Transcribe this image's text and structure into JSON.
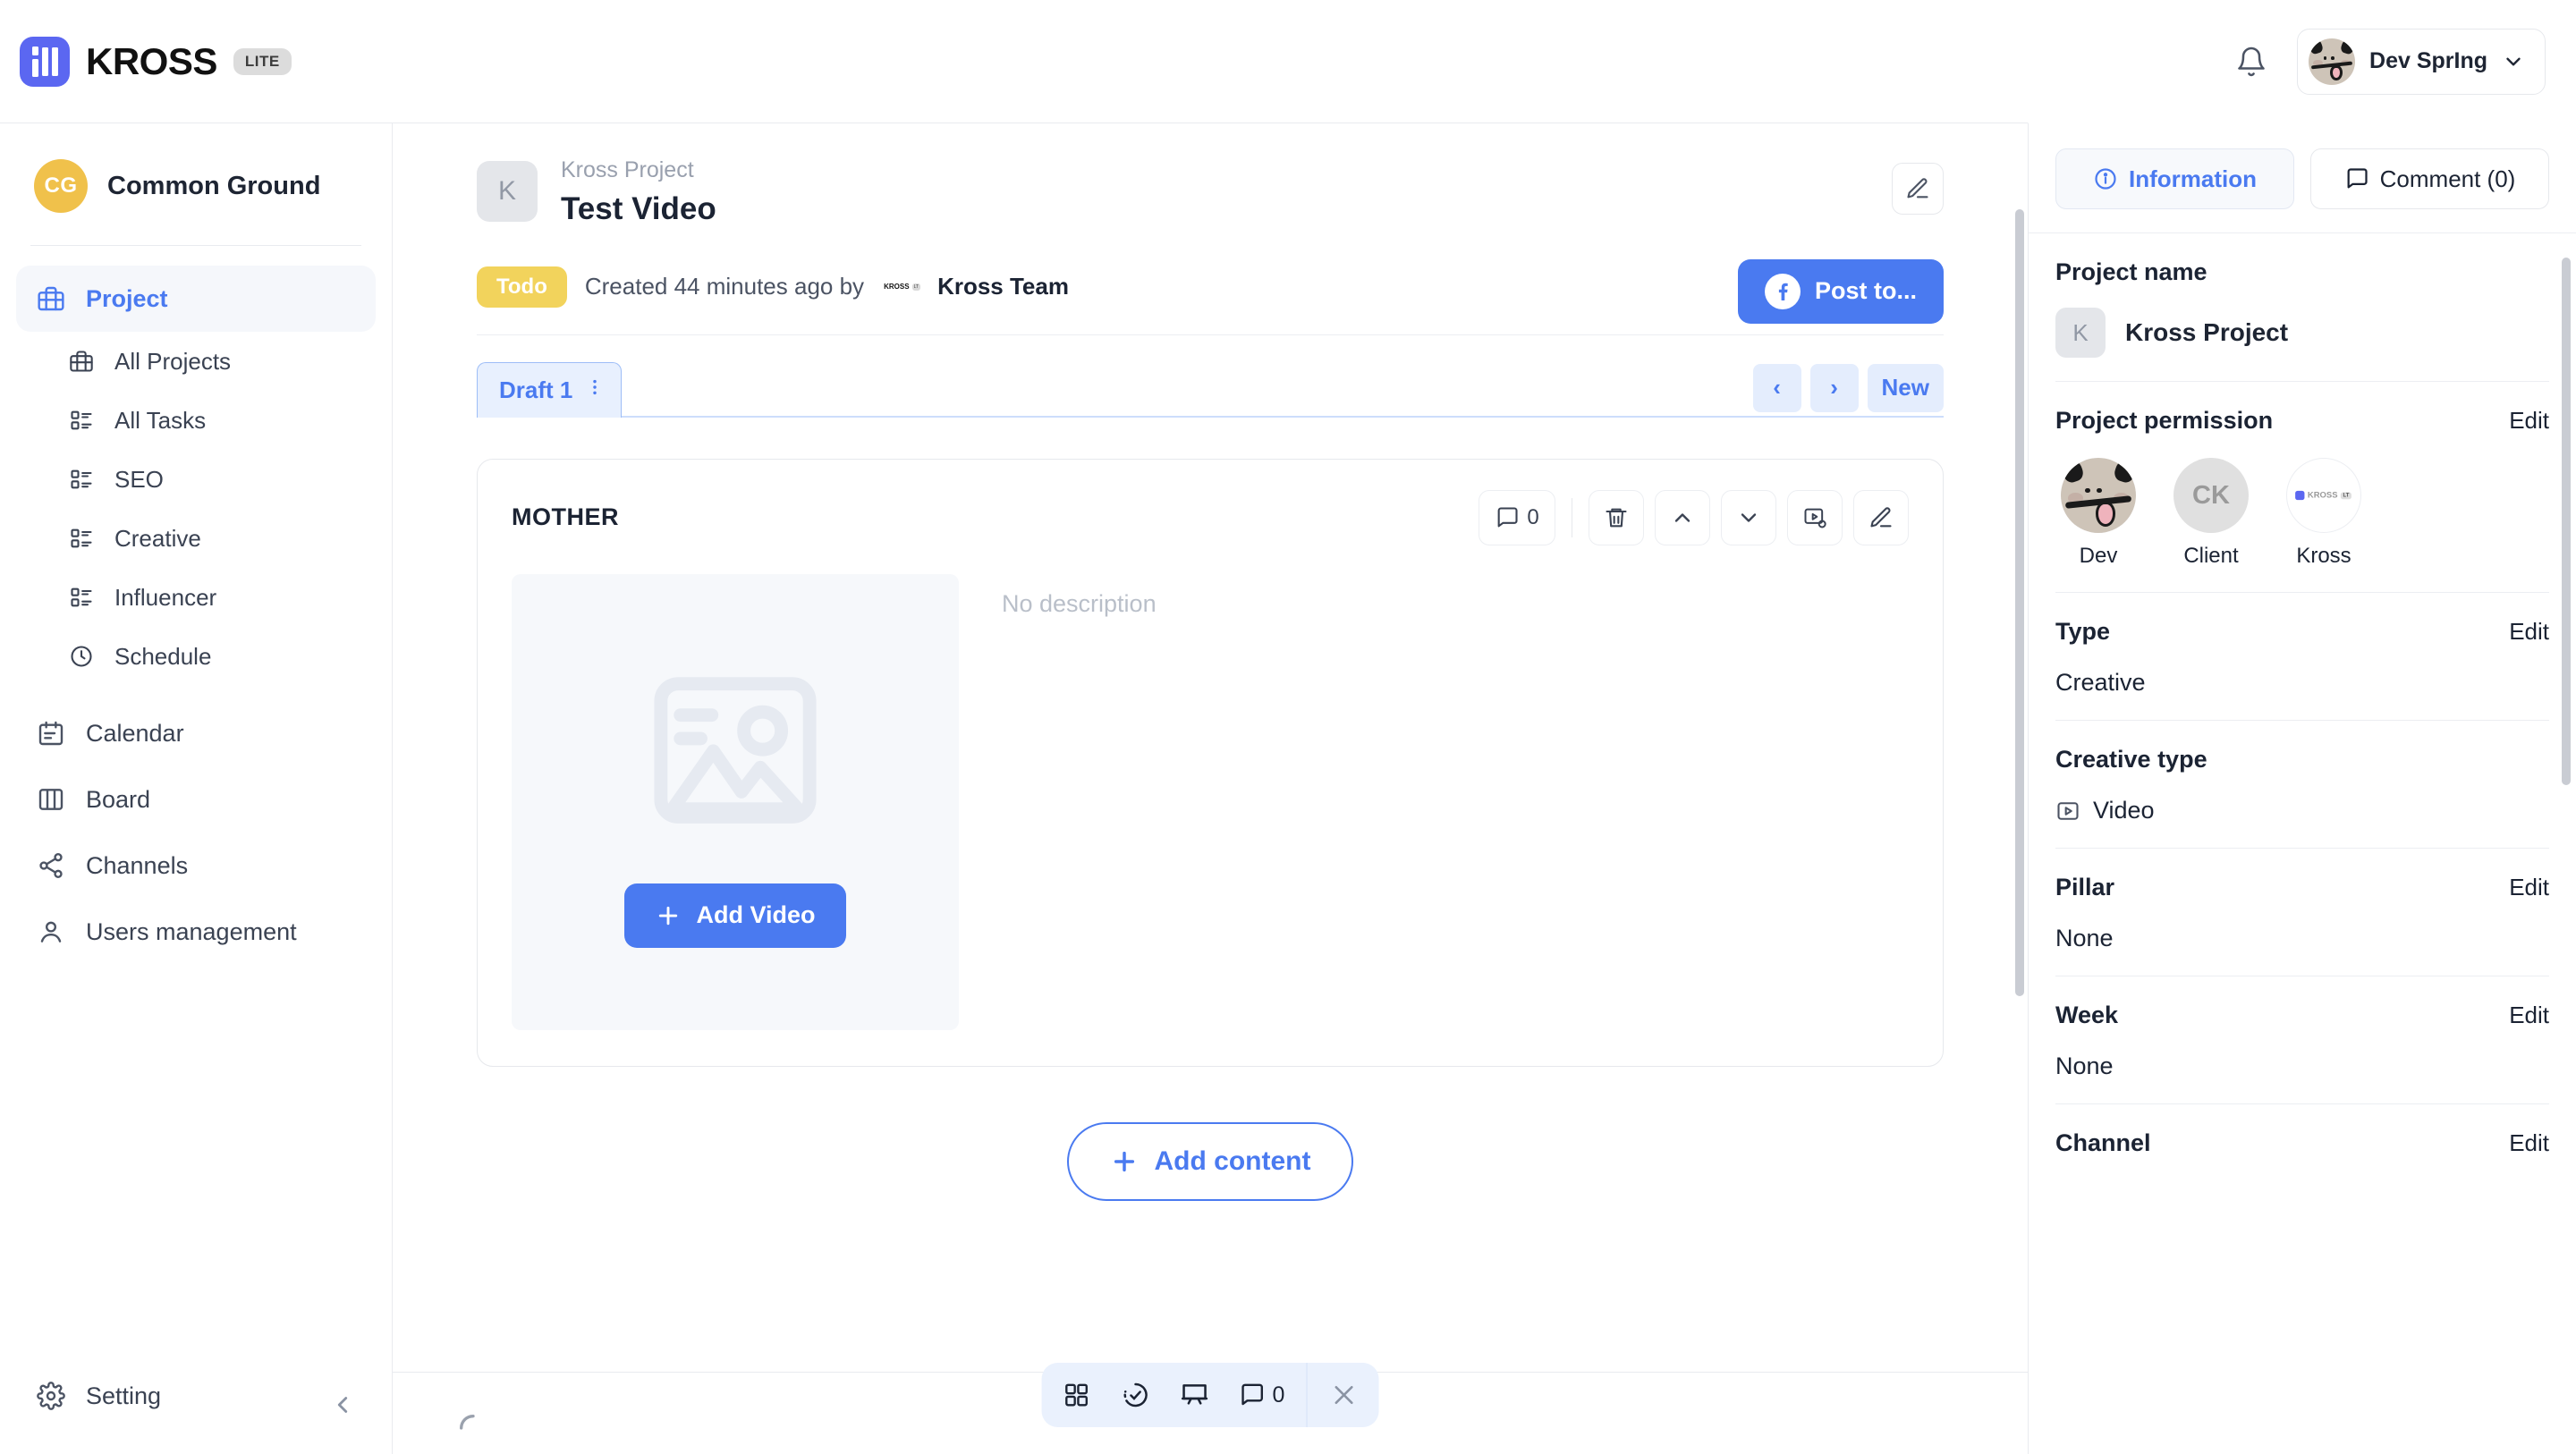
{
  "brand": {
    "name": "KROSS",
    "badge": "LITE",
    "logo_color": "#5b67f1"
  },
  "topbar": {
    "notifications_icon": "bell-icon",
    "user_name": "Dev SprIng",
    "chevron": "chevron-down-icon"
  },
  "sidebar": {
    "workspace": {
      "initials": "CG",
      "name": "Common Ground",
      "color": "#f0c14b"
    },
    "items": [
      {
        "label": "Project",
        "icon": "briefcase-icon",
        "active": true,
        "sub": false
      },
      {
        "label": "All Projects",
        "icon": "briefcase-icon",
        "active": false,
        "sub": true
      },
      {
        "label": "All Tasks",
        "icon": "list-layout-icon",
        "active": false,
        "sub": true
      },
      {
        "label": "SEO",
        "icon": "list-layout-icon",
        "active": false,
        "sub": true
      },
      {
        "label": "Creative",
        "icon": "list-layout-icon",
        "active": false,
        "sub": true
      },
      {
        "label": "Influencer",
        "icon": "list-layout-icon",
        "active": false,
        "sub": true
      },
      {
        "label": "Schedule",
        "icon": "clock-icon",
        "active": false,
        "sub": true
      },
      {
        "label": "Calendar",
        "icon": "calendar-icon",
        "active": false,
        "sub": false
      },
      {
        "label": "Board",
        "icon": "columns-icon",
        "active": false,
        "sub": false
      },
      {
        "label": "Channels",
        "icon": "share-nodes-icon",
        "active": false,
        "sub": false
      },
      {
        "label": "Users management",
        "icon": "user-icon",
        "active": false,
        "sub": false
      }
    ],
    "setting": {
      "label": "Setting",
      "icon": "gear-icon"
    },
    "collapse_icon": "chevron-left-icon"
  },
  "document": {
    "project_initial": "K",
    "project_label": "Kross Project",
    "title": "Test Video",
    "edit_icon": "pencil-icon",
    "status_badge": "Todo",
    "status_color": "#f2d35c",
    "created_text": "Created 44 minutes ago by",
    "author": "Kross Team",
    "post_button": "Post to...",
    "post_icon": "facebook-icon"
  },
  "drafts": {
    "tab_label": "Draft 1",
    "tab_menu_icon": "vertical-dots-icon",
    "prev_label": "‹",
    "next_label": "›",
    "new_label": "New"
  },
  "content_card": {
    "title": "MOTHER",
    "comment_count": "0",
    "tools": [
      {
        "name": "comment-icon",
        "label": "0"
      },
      {
        "name": "trash-icon",
        "label": ""
      },
      {
        "name": "chevron-up-icon",
        "label": ""
      },
      {
        "name": "chevron-down-icon",
        "label": ""
      },
      {
        "name": "video-settings-icon",
        "label": ""
      },
      {
        "name": "pencil-icon",
        "label": ""
      }
    ],
    "placeholder_icon": "image-placeholder-icon",
    "add_video_label": "Add Video",
    "no_description": "No description"
  },
  "add_content_label": "Add content",
  "float_toolbar": {
    "grid_icon": "grid-icon",
    "progress_icon": "progress-check-icon",
    "board_icon": "presentation-icon",
    "comment_icon": "comment-icon",
    "comment_count": "0",
    "close_icon": "close-icon"
  },
  "right_panel": {
    "tabs": [
      {
        "label": "Information",
        "icon": "info-icon",
        "active": true
      },
      {
        "label": "Comment (0)",
        "icon": "comment-icon",
        "active": false
      }
    ],
    "project_name_label": "Project name",
    "project_initial": "K",
    "project_name": "Kross Project",
    "permission_label": "Project permission",
    "permission_edit": "Edit",
    "people": [
      {
        "name": "Dev",
        "type": "face"
      },
      {
        "name": "Client",
        "type": "initials",
        "initials": "CK"
      },
      {
        "name": "Kross",
        "type": "logo"
      }
    ],
    "sections": [
      {
        "label": "Type",
        "edit": "Edit",
        "value": "Creative",
        "icon": ""
      },
      {
        "label": "Creative type",
        "edit": "",
        "value": "Video",
        "icon": "video-icon"
      },
      {
        "label": "Pillar",
        "edit": "Edit",
        "value": "None",
        "icon": ""
      },
      {
        "label": "Week",
        "edit": "Edit",
        "value": "None",
        "icon": ""
      },
      {
        "label": "Channel",
        "edit": "Edit",
        "value": "",
        "icon": ""
      }
    ]
  }
}
